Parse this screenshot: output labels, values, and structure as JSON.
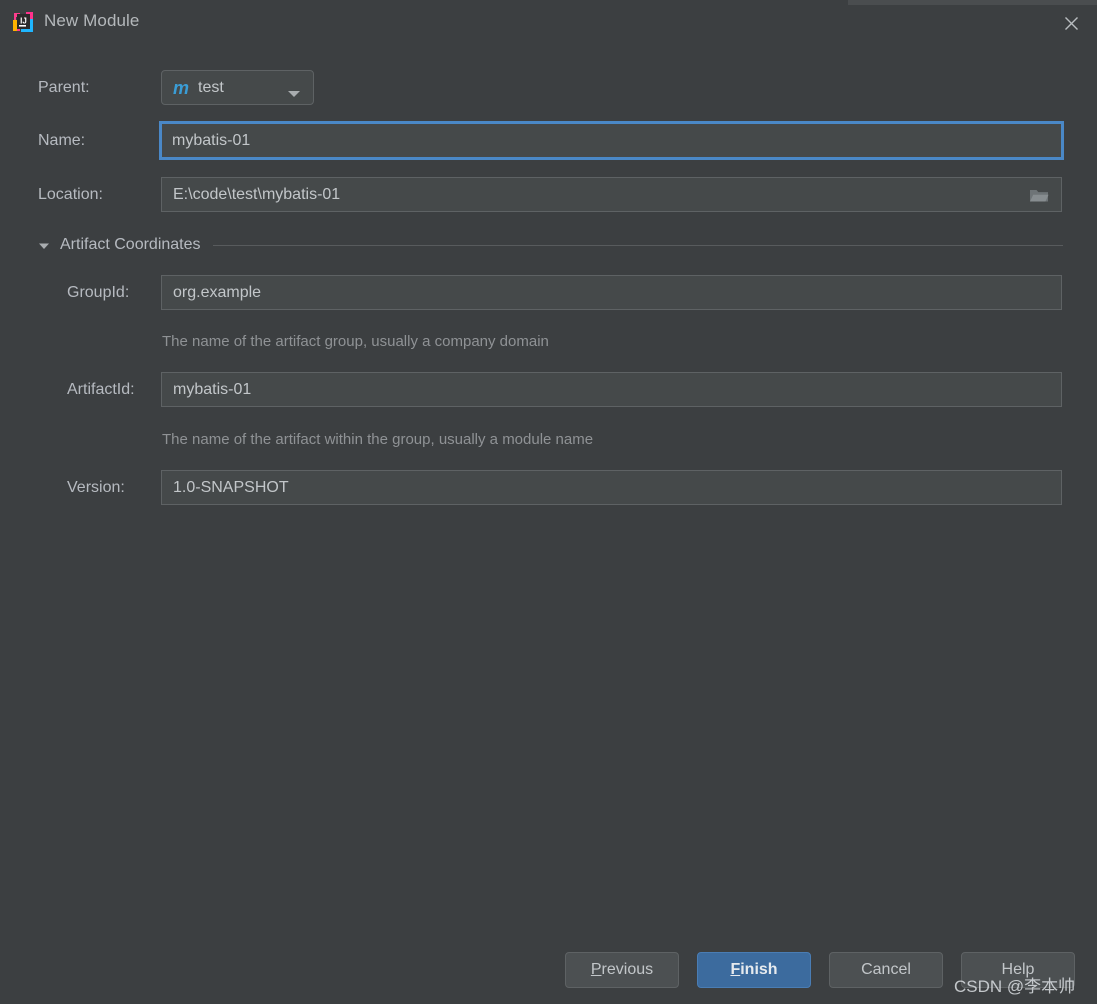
{
  "window": {
    "title": "New Module",
    "icon": "intellij-idea-icon",
    "close_icon": "close-icon"
  },
  "form": {
    "parent": {
      "label": "Parent:",
      "value": "test",
      "icon": "maven-module-icon",
      "chevron": "chevron-down-icon"
    },
    "name": {
      "label": "Name:",
      "value": "mybatis-01",
      "focused": true
    },
    "location": {
      "label": "Location:",
      "value": "E:\\code\\test\\mybatis-01",
      "browse_icon": "folder-icon"
    }
  },
  "artifact_section": {
    "title": "Artifact Coordinates",
    "expanded": true,
    "toggle_icon": "triangle-down-icon",
    "fields": {
      "group_id": {
        "label": "GroupId:",
        "value": "org.example",
        "hint": "The name of the artifact group, usually a company domain"
      },
      "artifact_id": {
        "label": "ArtifactId:",
        "value": "mybatis-01",
        "hint": "The name of the artifact within the group, usually a module name"
      },
      "version": {
        "label": "Version:",
        "value": "1.0-SNAPSHOT"
      }
    }
  },
  "buttons": {
    "previous": {
      "label": "Previous",
      "mnemonic": "P",
      "rest": "revious"
    },
    "finish": {
      "label": "Finish",
      "mnemonic": "F",
      "rest": "inish"
    },
    "cancel": {
      "label": "Cancel"
    },
    "help": {
      "label": "Help"
    }
  },
  "watermark": {
    "text": "CSDN @李本帅"
  },
  "colors": {
    "background": "#3c3f41",
    "field_background": "#45494a",
    "field_border": "#5e6264",
    "focus_border": "#4a88c7",
    "primary_button": "#3c6b9e",
    "text": "#c2c6c9",
    "hint_text": "#8f9295",
    "maven_icon": "#3a9dd6"
  }
}
